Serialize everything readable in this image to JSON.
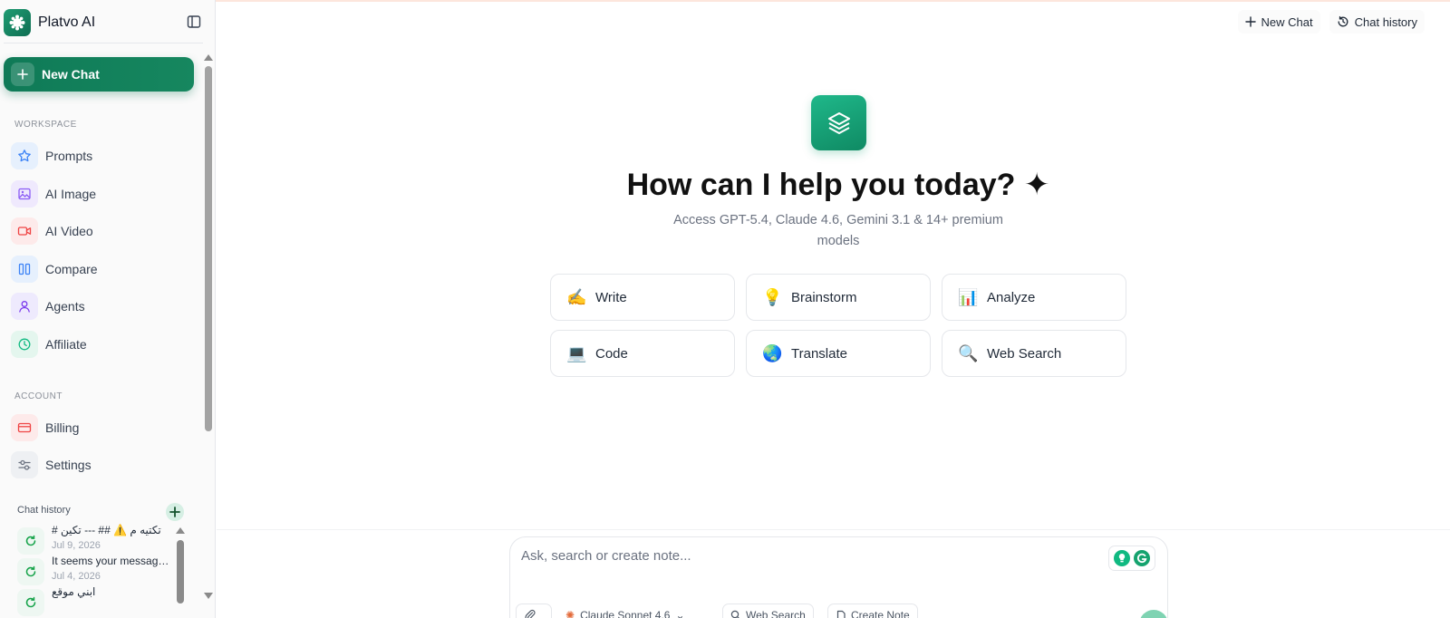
{
  "app": {
    "name": "Platvo AI"
  },
  "sidebar": {
    "new_chat_label": "New Chat",
    "workspace_label": "WORKSPACE",
    "workspace_items": [
      {
        "label": "Prompts",
        "icon": "star-icon",
        "color": "#3b82f6"
      },
      {
        "label": "AI Image",
        "icon": "image-icon",
        "color": "#8b5cf6"
      },
      {
        "label": "AI Video",
        "icon": "video-icon",
        "color": "#ef4444"
      },
      {
        "label": "Compare",
        "icon": "columns-icon",
        "color": "#3b82f6"
      },
      {
        "label": "Agents",
        "icon": "user-icon",
        "color": "#7c3aed"
      },
      {
        "label": "Affiliate",
        "icon": "clock-icon",
        "color": "#10b981"
      }
    ],
    "account_label": "ACCOUNT",
    "account_items": [
      {
        "label": "Billing",
        "icon": "credit-card-icon",
        "color": "#ef4444"
      },
      {
        "label": "Settings",
        "icon": "settings-icon",
        "color": "#6b7280"
      }
    ],
    "history": {
      "title": "Chat history",
      "items": [
        {
          "text": "# تكتيه م ⚠️ ## --- تكين",
          "date": "Jul 9, 2026"
        },
        {
          "text": "It seems your message got cut off",
          "date": "Jul 4, 2026"
        },
        {
          "text": "ابني موقع",
          "date": ""
        }
      ]
    }
  },
  "topbar": {
    "new_chat_label": "New Chat",
    "history_label": "Chat history"
  },
  "hero": {
    "title": "How can I help you today? ✦",
    "subtitle": "Access GPT-5.4, Claude 4.6, Gemini 3.1 & 14+ premium models"
  },
  "actions": [
    {
      "label": "Write",
      "emoji": "✍️"
    },
    {
      "label": "Brainstorm",
      "emoji": "💡"
    },
    {
      "label": "Analyze",
      "emoji": "📊"
    },
    {
      "label": "Code",
      "emoji": "💻"
    },
    {
      "label": "Translate",
      "emoji": "🌏"
    },
    {
      "label": "Web Search",
      "emoji": "🔍"
    }
  ],
  "composer": {
    "placeholder": "Ask, search or create note...",
    "model_label": "Claude Sonnet 4.6",
    "web_search_label": "Web Search",
    "create_note_label": "Create Note"
  },
  "colors": {
    "accent": "#128a62",
    "accent_light": "#1fb88a"
  }
}
